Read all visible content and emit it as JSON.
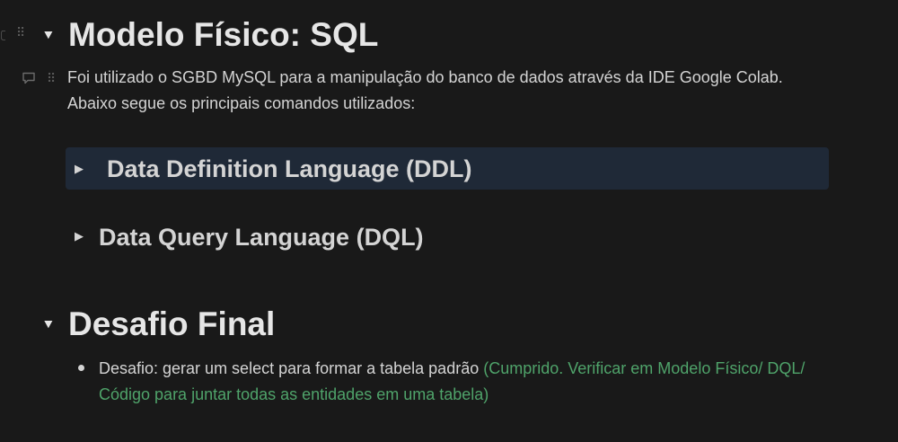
{
  "sections": {
    "modelo_fisico": {
      "heading": "Modelo Físico: SQL",
      "paragraph": "Foi utilizado o SGBD MySQL para a manipulação do banco de dados através da IDE Google Colab. Abaixo segue os principais comandos utilizados:",
      "toggles": [
        {
          "label": "Data Definition Language (DDL)"
        },
        {
          "label": "Data Query Language (DQL)"
        }
      ]
    },
    "desafio_final": {
      "heading": "Desafio Final",
      "bullet_text": "Desafio: gerar um select para formar a tabela padrão ",
      "bullet_status": "(Cumprido. Verificar em Modelo Físico/ DQL/ Código para juntar todas as entidades em uma tabela)"
    }
  },
  "icons": {
    "drag": "drag-handle-icon",
    "comment": "comment-icon",
    "toggle": "triangle-toggle-icon"
  },
  "colors": {
    "background": "#191919",
    "highlight": "#1f2937",
    "status_green": "#4fa36a"
  }
}
